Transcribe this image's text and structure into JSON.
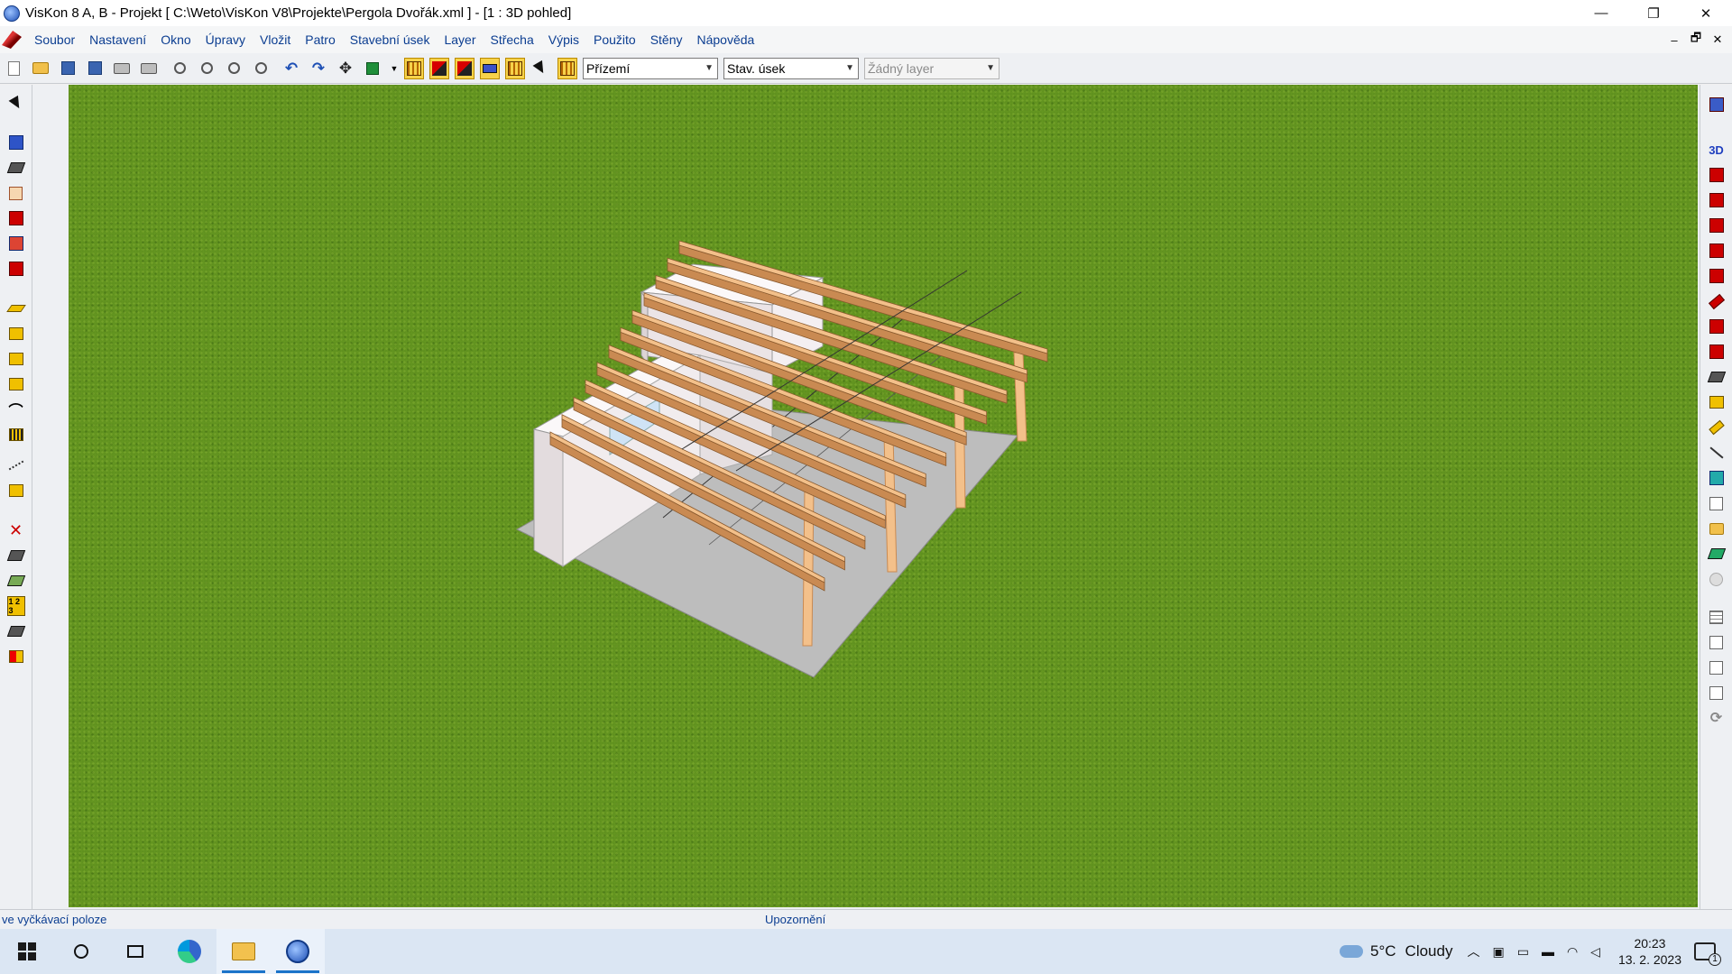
{
  "window": {
    "title": "VisKon 8 A, B - Projekt [ C:\\Weto\\VisKon V8\\Projekte\\Pergola Dvořák.xml ]  - [1 : 3D pohled]",
    "minimize": "—",
    "maximize": "❐",
    "close": "✕"
  },
  "menu": {
    "items": [
      "Soubor",
      "Nastavení",
      "Okno",
      "Úpravy",
      "Vložit",
      "Patro",
      "Stavební úsek",
      "Layer",
      "Střecha",
      "Výpis",
      "Použito",
      "Stěny",
      "Nápověda"
    ],
    "mdi_min": "–",
    "mdi_restore": "🗗",
    "mdi_close": "✕"
  },
  "toolbar": {
    "floor_select": "Přízemí",
    "section_select": "Stav. úsek",
    "layer_select": "Žádný layer"
  },
  "left_tools": {
    "dim_label": "1 2 3"
  },
  "right_tools": {
    "view3d_label": "3D"
  },
  "statusbar": {
    "left": "ve vyčkávací poloze",
    "center": "Upozornění"
  },
  "taskbar": {
    "weather_temp": "5°C",
    "weather_desc": "Cloudy",
    "time": "20:23",
    "date": "13. 2. 2023",
    "notification_count": "1"
  },
  "colors": {
    "grass": "#5e8f1e",
    "beam": "#f3c08a",
    "beam_dark": "#c98a52",
    "wall": "#f2eef0",
    "floor": "#bdbdbd",
    "accent": "#0b3d91"
  }
}
